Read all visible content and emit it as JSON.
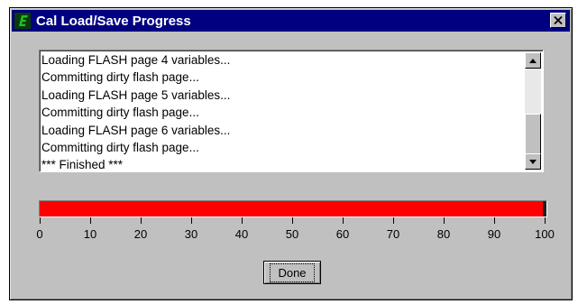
{
  "window": {
    "title": "Cal Load/Save Progress",
    "icon": "app-icon",
    "close_label": "X",
    "close_icon": "close-icon"
  },
  "log": {
    "lines": [
      "Loading FLASH page 4 variables...",
      "Committing dirty flash page...",
      "Loading FLASH page 5 variables...",
      "Committing dirty flash page...",
      "Loading FLASH page 6 variables...",
      "Committing dirty flash page...",
      "*** Finished ***"
    ]
  },
  "progress": {
    "percent": 100,
    "scale_labels": [
      "0",
      "10",
      "20",
      "30",
      "40",
      "50",
      "60",
      "70",
      "80",
      "90",
      "100"
    ],
    "fill_color": "#ff0000"
  },
  "buttons": {
    "done_label": "Done"
  },
  "colors": {
    "titlebar": "#000080",
    "dialog_bg": "#c0c0c0"
  }
}
